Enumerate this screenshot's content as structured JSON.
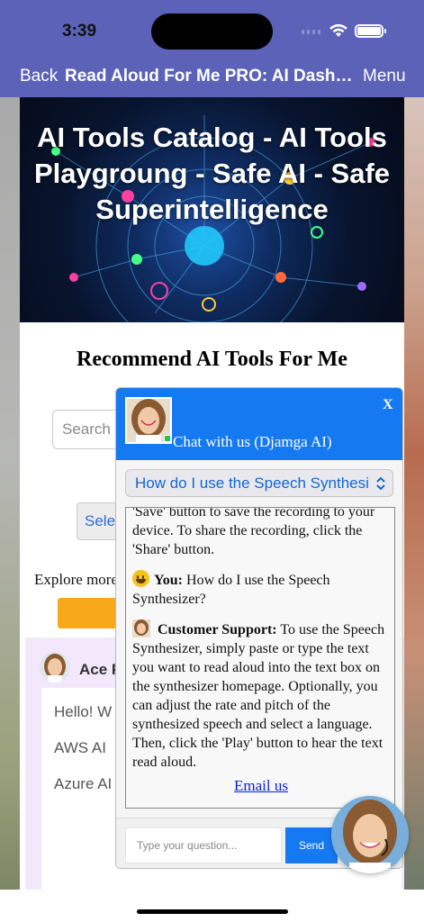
{
  "status_bar": {
    "time": "3:39"
  },
  "nav": {
    "back": "Back",
    "title": "Read Aloud For Me PRO: AI Dashboa...",
    "menu": "Menu"
  },
  "hero": {
    "title": "AI Tools Catalog - AI Tools Playgroung - Safe AI - Safe Superintelligence"
  },
  "page": {
    "recommend_title": "Recommend AI Tools For Me",
    "search_placeholder": "Search",
    "select_button": "Sele",
    "explore_text": "Explore more"
  },
  "assistant_card": {
    "name": "Ace P",
    "paragraphs": [
      "Hello! W Professi started, exam yo choose",
      "AWS AI",
      "Azure AI Fundamentals (AI-900),"
    ]
  },
  "chat_widget": {
    "title": "Chat with us (Djamga AI)",
    "close": "X",
    "selected_question": "How do I use the Speech Synthesi",
    "messages": [
      {
        "role": "assistant",
        "text": "'Save' button to save the recording to your device. To share the recording, click the 'Share' button."
      },
      {
        "role": "user",
        "label": "You:",
        "text": "How do I use the Speech Synthesizer?"
      },
      {
        "role": "assistant",
        "label": "Customer Support:",
        "text": "To use the Speech Synthesizer, simply paste or type the text you want to read aloud into the text box on the synthesizer homepage. Optionally, you can adjust the rate and pitch of the synthesized speech and select a language. Then, click the 'Play' button to hear the text read aloud."
      }
    ],
    "email_link": "Email us",
    "input_placeholder": "Type your question...",
    "send": "Send"
  },
  "colors": {
    "nav": "#5b62b8",
    "chat_blue": "#1579f2",
    "orange": "#f7a81b",
    "card_bg": "#f3e8fb"
  }
}
